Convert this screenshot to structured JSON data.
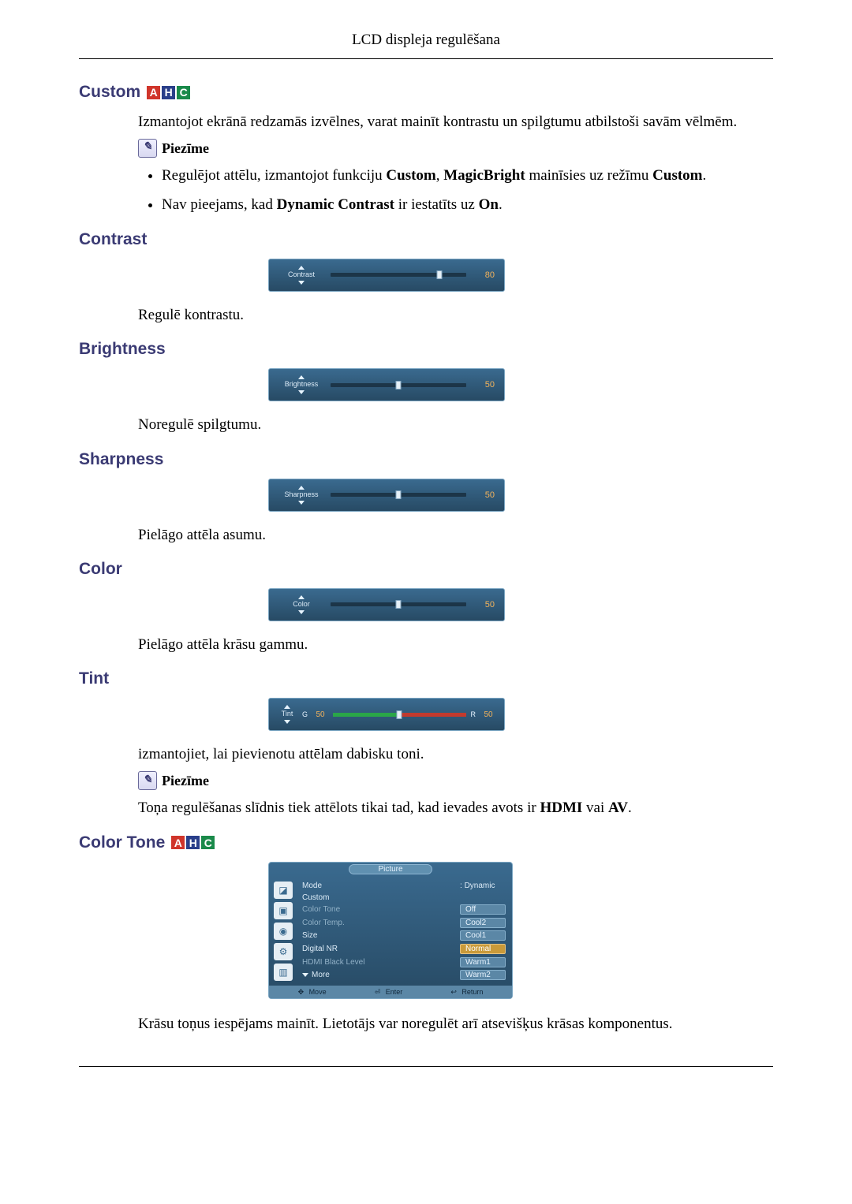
{
  "page_header": "LCD displeja regulēšana",
  "badges": {
    "a": "A",
    "h": "H",
    "c": "C"
  },
  "custom": {
    "title": "Custom",
    "intro": "Izmantojot ekrānā redzamās izvēlnes, varat mainīt kontrastu un spilgtumu atbilstoši savām vēlmēm.",
    "note_label": "Piezīme",
    "bullet1_pre": "Regulējot attēlu, izmantojot funkciju ",
    "bullet1_b1": "Custom",
    "bullet1_mid1": ", ",
    "bullet1_b2": "MagicBright",
    "bullet1_mid2": " mainīsies uz režīmu ",
    "bullet1_b3": "Custom",
    "bullet1_post": ".",
    "bullet2_pre": "Nav pieejams, kad ",
    "bullet2_b1": "Dynamic Contrast",
    "bullet2_mid": " ir iestatīts uz ",
    "bullet2_b2": "On",
    "bullet2_post": "."
  },
  "contrast": {
    "title": "Contrast",
    "osd_label": "Contrast",
    "value": "80",
    "percent": 80,
    "desc": "Regulē kontrastu."
  },
  "brightness": {
    "title": "Brightness",
    "osd_label": "Brightness",
    "value": "50",
    "percent": 50,
    "desc": "Noregulē spilgtumu."
  },
  "sharpness": {
    "title": "Sharpness",
    "osd_label": "Sharpness",
    "value": "50",
    "percent": 50,
    "desc": "Pielāgo attēla asumu."
  },
  "color": {
    "title": "Color",
    "osd_label": "Color",
    "value": "50",
    "percent": 50,
    "desc": "Pielāgo attēla krāsu gammu."
  },
  "tint": {
    "title": "Tint",
    "osd_label": "Tint",
    "g_label": "G",
    "g_value": "50",
    "r_label": "R",
    "r_value": "50",
    "percent": 50,
    "desc": "izmantojiet, lai pievienotu attēlam dabisku toni.",
    "note_label": "Piezīme",
    "note_text_pre": "Toņa regulēšanas slīdnis tiek attēlots tikai tad, kad ievades avots ir ",
    "note_b1": "HDMI",
    "note_mid": " vai ",
    "note_b2": "AV",
    "note_post": "."
  },
  "color_tone": {
    "title": "Color Tone",
    "menu_title": "Picture",
    "items": [
      {
        "label": "Mode",
        "value": "Dynamic",
        "dim": false,
        "pill": false
      },
      {
        "label": "Custom",
        "value": "",
        "dim": false,
        "pill": false
      },
      {
        "label": "Color Tone",
        "value": "Off",
        "dim": true,
        "pill": true,
        "hl": false
      },
      {
        "label": "Color Temp.",
        "value": "Cool2",
        "dim": true,
        "pill": true,
        "hl": false
      },
      {
        "label": "Size",
        "value": "Cool1",
        "dim": false,
        "pill": true,
        "hl": false
      },
      {
        "label": "Digital NR",
        "value": "Normal",
        "dim": false,
        "pill": true,
        "hl": true
      },
      {
        "label": "HDMI Black Level",
        "value": "Warm1",
        "dim": true,
        "pill": true,
        "hl": false
      },
      {
        "label": "More",
        "value": "Warm2",
        "dim": false,
        "pill": true,
        "hl": false,
        "more": true
      }
    ],
    "footer": {
      "move": "Move",
      "enter": "Enter",
      "return": "Return"
    },
    "desc": "Krāsu toņus iespējams mainīt. Lietotājs var noregulēt arī atsevišķus krāsas komponentus."
  }
}
